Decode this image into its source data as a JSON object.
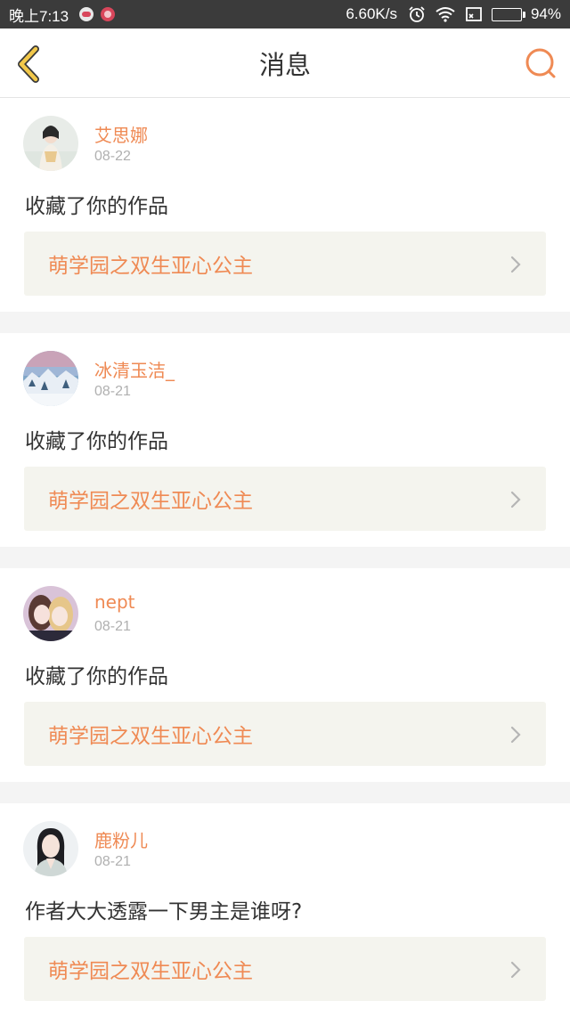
{
  "status_bar": {
    "time": "晚上7:13",
    "speed": "6.60K/s",
    "battery_text": "94%",
    "battery_level": 0.94,
    "battery_color": "#3ee03e",
    "icons": [
      "alarm-icon",
      "wifi-icon",
      "cast-icon",
      "battery-icon"
    ]
  },
  "header": {
    "title": "消息",
    "back_icon": "chevron-left-icon",
    "search_icon": "search-icon",
    "accent": "#ef8a54",
    "back_color": "#f2c84a"
  },
  "messages": [
    {
      "username": "艾思娜",
      "date": "08-22",
      "text": "收藏了你的作品",
      "work_title": "萌学园之双生亚心公主"
    },
    {
      "username": "冰清玉洁_",
      "date": "08-21",
      "text": "收藏了你的作品",
      "work_title": "萌学园之双生亚心公主"
    },
    {
      "username": "nept",
      "date": "08-21",
      "text": "收藏了你的作品",
      "work_title": "萌学园之双生亚心公主"
    },
    {
      "username": "鹿粉儿",
      "date": "08-21",
      "text": "作者大大透露一下男主是谁呀?",
      "work_title": "萌学园之双生亚心公主"
    }
  ]
}
